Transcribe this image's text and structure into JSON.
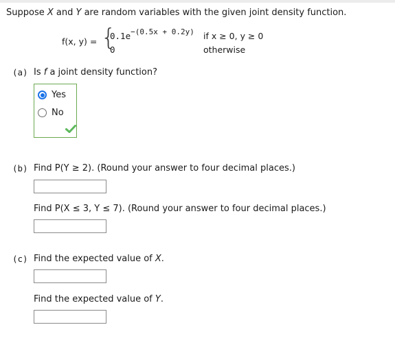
{
  "intro": {
    "prefix": "Suppose ",
    "var_x": "X",
    "middle": " and ",
    "var_y": "Y",
    "suffix": " are random variables with the given joint density function."
  },
  "density": {
    "lhs": "f(x, y) =",
    "case1_base": "0.1e",
    "case1_exponent": "−(0.5x + 0.2y)",
    "case1_condition": "if x ≥ 0, y ≥ 0",
    "case2_value": "0",
    "case2_condition": "otherwise"
  },
  "part_a": {
    "label": "(a)",
    "question_prefix": "Is ",
    "question_var": "f",
    "question_suffix": " a joint density function?",
    "options": [
      {
        "label": "Yes",
        "selected": true
      },
      {
        "label": "No",
        "selected": false
      }
    ],
    "status": "correct",
    "accent_color": "#1a73e8",
    "correct_color": "#5cb85c"
  },
  "part_b": {
    "label": "(b)",
    "q1": "Find P(Y ≥ 2). (Round your answer to four decimal places.)",
    "q1_value": "",
    "q2": "Find P(X ≤ 3, Y ≤ 7). (Round your answer to four decimal places.)",
    "q2_value": ""
  },
  "part_c": {
    "label": "(c)",
    "q1_prefix": "Find the expected value of ",
    "q1_var": "X",
    "q1_suffix": ".",
    "q1_value": "",
    "q2_prefix": "Find the expected value of ",
    "q2_var": "Y",
    "q2_suffix": ".",
    "q2_value": ""
  }
}
